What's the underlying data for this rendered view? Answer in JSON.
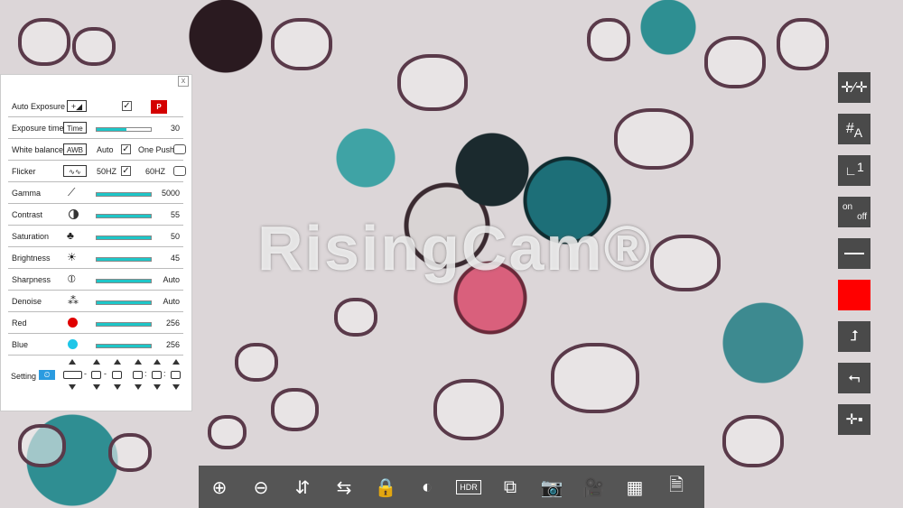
{
  "watermark": "RisingCam®",
  "panel": {
    "close_label": "x",
    "auto_exposure": {
      "label": "Auto Exposure",
      "checked": true,
      "logo_text": "P"
    },
    "exposure_time": {
      "label": "Exposure time",
      "icon_text": "Time",
      "value": "30"
    },
    "white_balance": {
      "label": "White balance",
      "icon_text": "AWB",
      "auto_label": "Auto",
      "auto_checked": true,
      "one_push_label": "One Push"
    },
    "flicker": {
      "label": "Flicker",
      "opt1_label": "50HZ",
      "opt1_checked": true,
      "opt2_label": "60HZ"
    },
    "gamma": {
      "label": "Gamma",
      "value": "5000"
    },
    "contrast": {
      "label": "Contrast",
      "value": "55"
    },
    "saturation": {
      "label": "Saturation",
      "value": "50"
    },
    "brightness": {
      "label": "Brightness",
      "value": "45"
    },
    "sharpness": {
      "label": "Sharpness",
      "value": "Auto"
    },
    "denoise": {
      "label": "Denoise",
      "value": "Auto"
    },
    "red": {
      "label": "Red",
      "value": "256",
      "color": "#e00000"
    },
    "blue": {
      "label": "Blue",
      "value": "256",
      "color": "#1ec6e8"
    },
    "setting": {
      "label": "Setting",
      "sep1": "-",
      "sep2": "-",
      "sep3": ":",
      "sep4": ":"
    }
  },
  "right_toolbar": {
    "onoff_on": "on",
    "onoff_off": "off",
    "grid_label": "A",
    "number_label": "1"
  },
  "bottom_toolbar": {
    "hdr_label": "HDR"
  },
  "colors": {
    "accent": "#1ec6c8",
    "record": "#ff0000",
    "toolbar": "#4a4a4a"
  }
}
